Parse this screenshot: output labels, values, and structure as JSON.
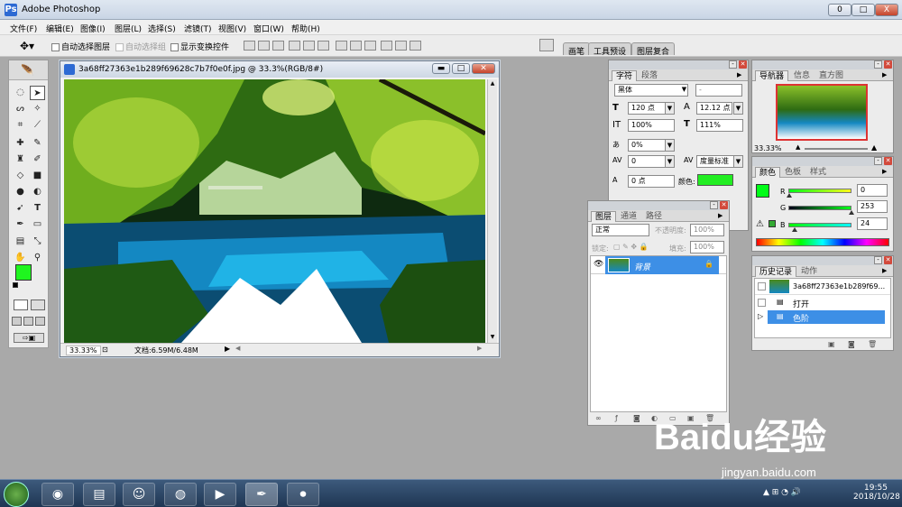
{
  "app": {
    "title": "Adobe Photoshop",
    "icon": "photoshop-icon"
  },
  "window_buttons": [
    "0",
    "□",
    "X"
  ],
  "menu": [
    "文件(F)",
    "编辑(E)",
    "图像(I)",
    "图层(L)",
    "选择(S)",
    "滤镜(T)",
    "视图(V)",
    "窗口(W)",
    "帮助(H)"
  ],
  "options_bar": {
    "auto_select_layer": "自动选择图层",
    "auto_select_group": "自动选择组",
    "show_transform": "显示变换控件"
  },
  "dock_tabs": [
    "画笔",
    "工具预设",
    "图层复合"
  ],
  "document": {
    "title": "3a68ff27363e1b289f69628c7b7f0e0f.jpg @ 33.3%(RGB/8#)",
    "zoom": "33.33%",
    "doc_size": "文档:6.59M/6.48M"
  },
  "character_panel": {
    "tabs": [
      "字符",
      "段落"
    ],
    "font_family": "黑体",
    "font_style": "-",
    "font_size": "120 点",
    "leading": "12.12 点",
    "vertical_scale": "100%",
    "horizontal_scale": "111%",
    "tsume": "0%",
    "kerning": "0",
    "tracking": "度量标准",
    "baseline_shift": "0 点",
    "color_label": "颜色:",
    "color_value": "#22ee22"
  },
  "layers_panel": {
    "tabs": [
      "图层",
      "通道",
      "路径"
    ],
    "blend_mode": "正常",
    "opacity_label": "不透明度:",
    "opacity": "100%",
    "lock_label": "锁定:",
    "fill_label": "填充:",
    "fill": "100%",
    "layer_name": "背景"
  },
  "navigator_panel": {
    "tabs": [
      "导航器",
      "信息",
      "直方图"
    ],
    "zoom": "33.33%"
  },
  "color_panel": {
    "tabs": [
      "颜色",
      "色板",
      "样式"
    ],
    "labels": [
      "R",
      "G",
      "B"
    ],
    "values": [
      "0",
      "253",
      "24"
    ],
    "fg_color": "#00fd18"
  },
  "history_panel": {
    "tabs": [
      "历史记录",
      "动作"
    ],
    "snapshot": "3a68ff27363e1b289f69...",
    "steps": [
      "打开",
      "色阶"
    ]
  },
  "taskbar": {
    "time": "19:55",
    "date": "2018/10/28"
  },
  "watermark": {
    "brand": "Baidu经验",
    "url": "jingyan.baidu.com"
  }
}
